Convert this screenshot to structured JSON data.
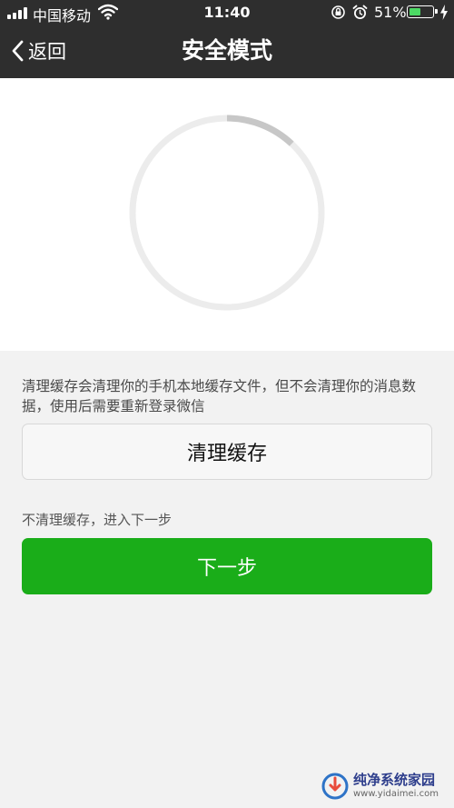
{
  "status_bar": {
    "carrier": "中国移动",
    "time": "11:40",
    "battery_percent": "51%",
    "battery_level": 0.51
  },
  "nav": {
    "back_label": "返回",
    "title": "安全模式"
  },
  "progress": {
    "value": 0.12,
    "track_color": "#ececec",
    "indicator_color": "#c7c7c7"
  },
  "content": {
    "description": "清理缓存会清理你的手机本地缓存文件，但不会清理你的消息数据，使用后需要重新登录微信",
    "clear_button_label": "清理缓存",
    "skip_hint": "不清理缓存，进入下一步",
    "next_button_label": "下一步"
  },
  "colors": {
    "header_bg": "#2e2e2e",
    "primary_green": "#1aad19",
    "battery_green": "#4cd964"
  },
  "watermark": {
    "name": "纯净系统家园",
    "url": "www.yidaimei.com"
  }
}
